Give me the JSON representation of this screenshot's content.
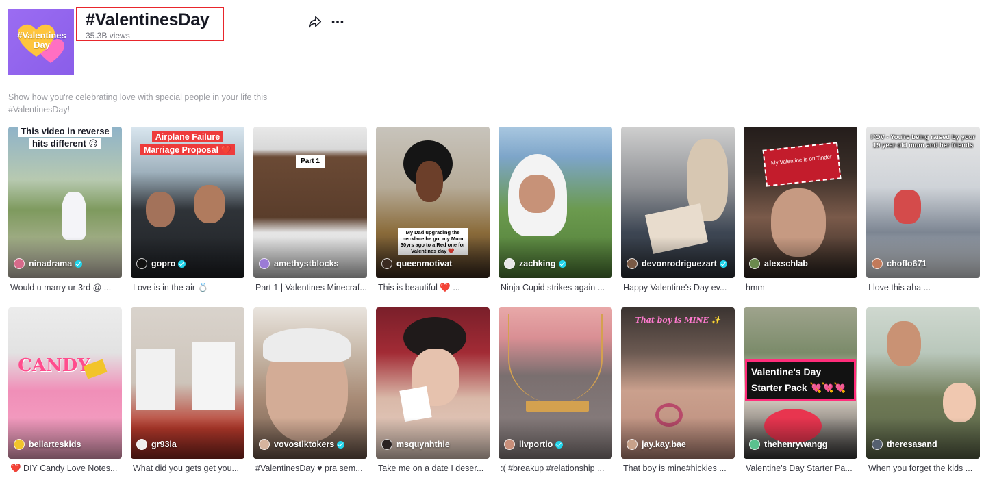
{
  "hashtag": {
    "title": "#ValentinesDay",
    "views": "35.3B views",
    "cover_text_line1": "#Valentines",
    "cover_text_line2": "Day",
    "description": "Show how you're celebrating love with special people in your life this #ValentinesDay!"
  },
  "colors": {
    "highlight_border": "#e8262c",
    "verified_badge": "#20d5ec",
    "cover_bg": "#9b6cf2"
  },
  "videos": [
    {
      "creator": "ninadrama",
      "verified": true,
      "caption": "Would u marry ur 3rd @ ...",
      "overlay": "This video in reverse hits different 😥"
    },
    {
      "creator": "gopro",
      "verified": true,
      "caption": "Love is in the air 💍",
      "overlay": "Airplane Failure Marriage Proposal ❤️"
    },
    {
      "creator": "amethystblocks",
      "verified": false,
      "caption": "Part 1 | Valentines Minecraf...",
      "overlay": "Part 1"
    },
    {
      "creator": "queenmotivat",
      "verified": false,
      "caption": "This is beautiful ❤️ ...",
      "overlay": "My Dad upgrading the necklace he got my Mum 30yrs ago to a Red one for Valentines day ❤️"
    },
    {
      "creator": "zachking",
      "verified": true,
      "caption": "Ninja Cupid strikes again ...",
      "overlay": ""
    },
    {
      "creator": "devonrodriguezart",
      "verified": true,
      "caption": "Happy Valentine's Day ev...",
      "overlay": ""
    },
    {
      "creator": "alexschlab",
      "verified": false,
      "caption": "hmm",
      "overlay": "My Valentine is on Tinder"
    },
    {
      "creator": "choflo671",
      "verified": false,
      "caption": "I love this aha ...",
      "overlay": "POV - You're being raised by your 19 year old mum and her friends"
    },
    {
      "creator": "bellarteskids",
      "verified": false,
      "caption": "❤️ DIY Candy Love Notes...",
      "overlay": "CANDY"
    },
    {
      "creator": "gr93la",
      "verified": false,
      "caption": "What did you gets get you...",
      "overlay": ""
    },
    {
      "creator": "vovostiktokers",
      "verified": true,
      "caption": "#ValentinesDay ♥ pra sem...",
      "overlay": ""
    },
    {
      "creator": "msquynhthie",
      "verified": false,
      "caption": "Take me on a date I deser...",
      "overlay": ""
    },
    {
      "creator": "livportio",
      "verified": true,
      "caption": ":( #breakup #relationship ...",
      "overlay": ""
    },
    {
      "creator": "jay.kay.bae",
      "verified": false,
      "caption": "That boy is mine#hickies ...",
      "overlay": "That boy is MINE ✨"
    },
    {
      "creator": "thehenrywangg",
      "verified": false,
      "caption": "Valentine's Day Starter Pa...",
      "overlay": "Valentine's Day Starter Pack 💘💘💘"
    },
    {
      "creator": "theresasand",
      "verified": false,
      "caption": "When you forget the kids ...",
      "overlay": ""
    }
  ]
}
